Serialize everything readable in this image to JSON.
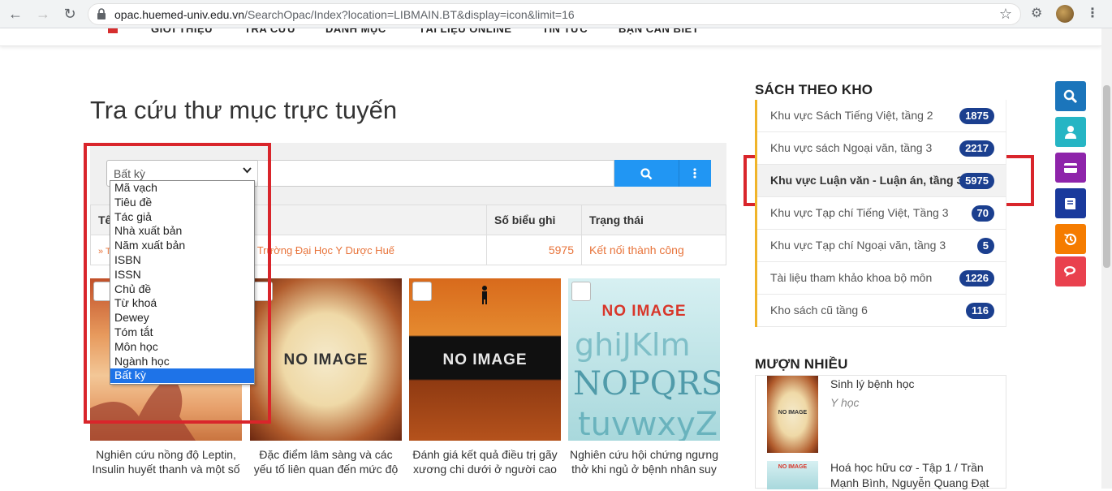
{
  "browser": {
    "url_host": "opac.huemed-univ.edu.vn",
    "url_path": "/SearchOpac/Index?location=LIBMAIN.BT&display=icon&limit=16"
  },
  "site_nav": {
    "items": [
      "GIỚI THIỆU",
      "TRA CỨU",
      "DANH MỤC",
      "TÀI LIỆU ONLINE",
      "TIN TỨC",
      "BẠN CẦN BIẾT"
    ]
  },
  "page": {
    "title": "Tra cứu thư mục trực tuyến"
  },
  "search": {
    "field_selected": "Bất kỳ",
    "query": "",
    "options": [
      "Mã vạch",
      "Tiêu đề",
      "Tác giả",
      "Nhà xuất bản",
      "Năm xuất bản",
      "ISBN",
      "ISSN",
      "Chủ đề",
      "Từ khoá",
      "Dewey",
      "Tóm tắt",
      "Môn học",
      "Ngành học",
      "Bất kỳ"
    ]
  },
  "results_table": {
    "headers": {
      "name": "Tê",
      "count": "Số biểu ghi",
      "status": "Trạng thái"
    },
    "rows": [
      {
        "name": "Trường Đại Học Y Dược Huế",
        "count": "5975",
        "status": "Kết nối thành công"
      }
    ]
  },
  "books": [
    {
      "title_line1": "Nghiên cứu nồng độ Leptin,",
      "title_line2": "Insulin huyết thanh và một số",
      "cover_text": ""
    },
    {
      "title_line1": "Đặc điểm lâm sàng và các",
      "title_line2": "yếu tố liên quan đến mức độ",
      "cover_text": "NO IMAGE"
    },
    {
      "title_line1": "Đánh giá kết quả điều trị gãy",
      "title_line2": "xương chi dưới ở người cao",
      "cover_text": "NO IMAGE"
    },
    {
      "title_line1": "Nghiên cứu hội chứng ngưng",
      "title_line2": "thở khi ngủ ở bệnh nhân suy",
      "cover_text": "NO IMAGE"
    }
  ],
  "sidebar": {
    "shelves_heading": "SÁCH THEO KHO",
    "shelves": [
      {
        "label": "Khu vực Sách Tiếng Việt, tầng 2",
        "count": "1875"
      },
      {
        "label": "Khu vực sách Ngoại văn, tầng 3",
        "count": "2217"
      },
      {
        "label": "Khu vực Luận văn - Luận án, tầng 3",
        "count": "5975"
      },
      {
        "label": "Khu vực Tạp chí Tiếng Việt, Tầng 3",
        "count": "70"
      },
      {
        "label": "Khu vực Tạp chí Ngoại văn, tầng 3",
        "count": "5"
      },
      {
        "label": "Tài liệu tham khảo khoa bộ môn",
        "count": "1226"
      },
      {
        "label": "Kho sách cũ tầng 6",
        "count": "116"
      }
    ],
    "borrow_heading": "MƯỢN NHIỀU",
    "borrowed": [
      {
        "title": "Sinh lý bệnh học",
        "subtitle": "Y học",
        "thumb_text": "NO IMAGE"
      },
      {
        "title": "Hoá học hữu cơ - Tập 1 / Trần Mạnh Bình, Nguyễn Quang Đạt",
        "subtitle": "",
        "thumb_text": "NO IMAGE"
      }
    ]
  },
  "colors": {
    "primary_blue": "#2196f3",
    "badge_navy": "#1b3f8f",
    "accent_orange": "#e8743b",
    "highlight_red": "#d9252b",
    "shelf_accent": "#f0b429"
  },
  "fabs": [
    {
      "icon": "search-icon",
      "color": "#1b75bb"
    },
    {
      "icon": "user-icon",
      "color": "#26b5c4"
    },
    {
      "icon": "card-icon",
      "color": "#8e24aa"
    },
    {
      "icon": "book-icon",
      "color": "#1a3a9c"
    },
    {
      "icon": "history-icon",
      "color": "#f57c00"
    },
    {
      "icon": "chat-icon",
      "color": "#e9414e"
    }
  ]
}
